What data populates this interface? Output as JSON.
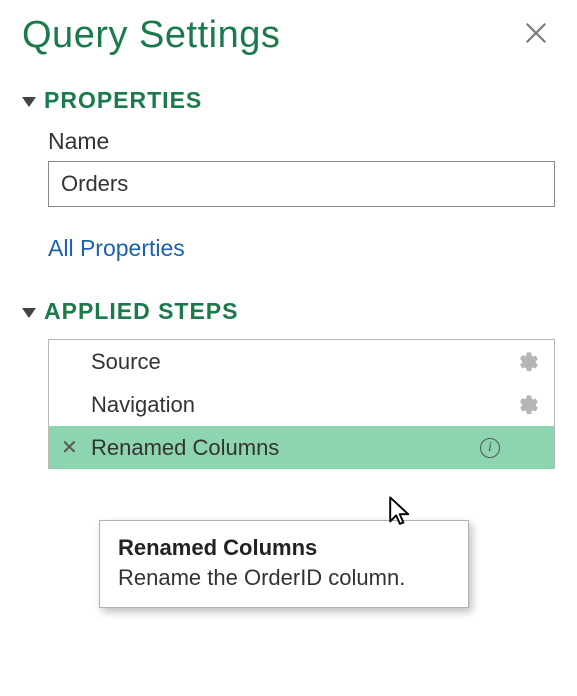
{
  "header": {
    "title": "Query Settings"
  },
  "properties": {
    "section_label": "PROPERTIES",
    "name_label": "Name",
    "name_value": "Orders",
    "all_properties_link": "All Properties"
  },
  "applied_steps": {
    "section_label": "APPLIED STEPS",
    "steps": [
      {
        "label": "Source",
        "has_gear": true,
        "selected": false,
        "has_info": false
      },
      {
        "label": "Navigation",
        "has_gear": true,
        "selected": false,
        "has_info": false
      },
      {
        "label": "Renamed Columns",
        "has_gear": false,
        "selected": true,
        "has_info": true
      }
    ]
  },
  "tooltip": {
    "title": "Renamed Columns",
    "description": "Rename the OrderID column."
  }
}
